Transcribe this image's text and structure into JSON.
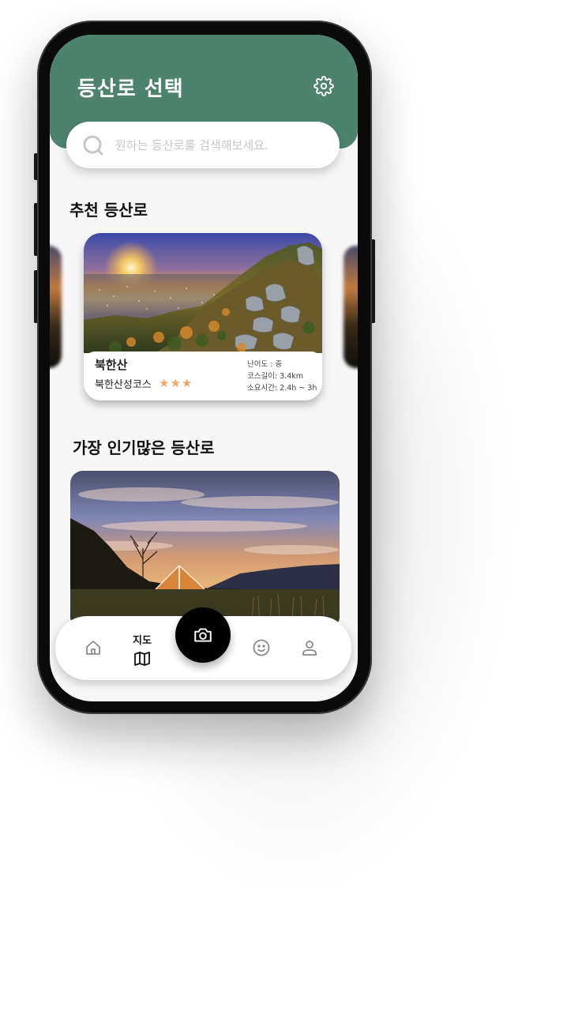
{
  "header": {
    "title": "등산로 선택",
    "settings_icon": "gear-icon",
    "background": "#4d836d"
  },
  "search": {
    "placeholder": "원하는 등산로를 검색해보세요."
  },
  "recommended": {
    "section_title": "추천 등산로",
    "card": {
      "mountain": "북한산",
      "course": "북한산성코스",
      "stars": "★★★",
      "rating": 3,
      "difficulty": "난이도 : 중",
      "length": "코스길이: 3.4km",
      "duration": "소요시간: 2.4h ~ 3h"
    }
  },
  "popular": {
    "section_title": "가장 인기많은 등산로"
  },
  "nav": {
    "items": [
      {
        "icon": "home-icon"
      },
      {
        "icon": "map-icon",
        "label": "지도"
      },
      {
        "icon": "camera-icon"
      },
      {
        "icon": "smiley-icon"
      },
      {
        "icon": "user-icon"
      }
    ]
  },
  "colors": {
    "accent": "#4d836d",
    "star": "#f2a56b"
  }
}
